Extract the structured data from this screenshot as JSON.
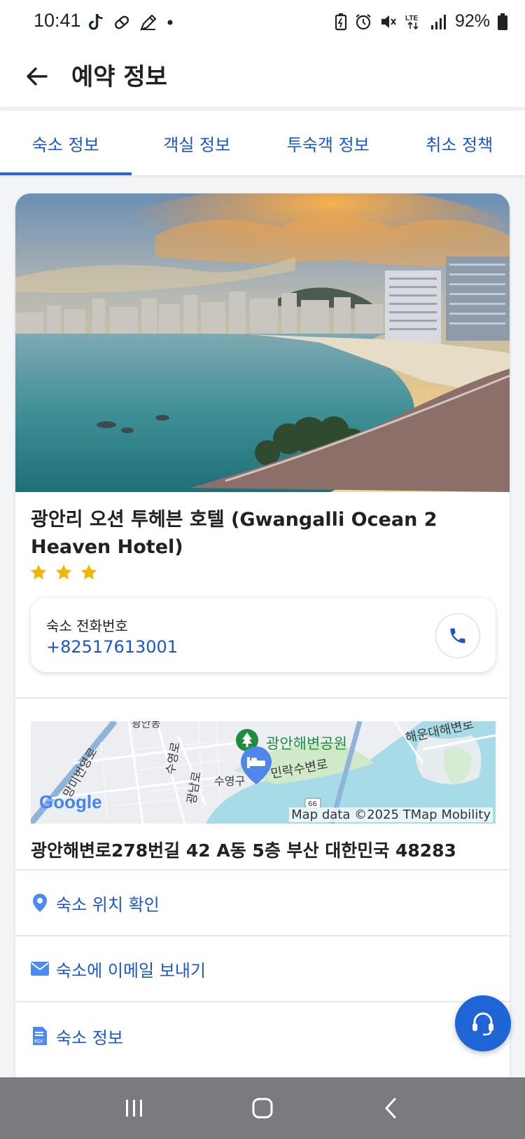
{
  "status_bar": {
    "time": "10:41",
    "battery_percent": "92%",
    "network": "LTE",
    "left_icons": [
      "tiktok-icon",
      "pill-icon",
      "pencil-icon",
      "dot-icon"
    ],
    "right_icons": [
      "battery-saver-icon",
      "alarm-icon",
      "mute-icon",
      "lte-icon",
      "signal-icon",
      "battery-icon"
    ]
  },
  "app_bar": {
    "title": "예약 정보",
    "back_icon": "arrow-left-icon"
  },
  "tabs": [
    {
      "label": "숙소 정보",
      "active": true
    },
    {
      "label": "객실 정보",
      "active": false
    },
    {
      "label": "투숙객 정보",
      "active": false
    },
    {
      "label": "취소 정책",
      "active": false
    }
  ],
  "hotel": {
    "name": "광안리 오션 투헤븐 호텔 (Gwangalli Ocean 2 Heaven Hotel)",
    "star_rating": 3,
    "star_color": "#f4b400",
    "phone_label": "숙소 전화번호",
    "phone_number": "+82517613001"
  },
  "map": {
    "labels": {
      "park": "광안해변공원",
      "road_top_right": "해운대해변로",
      "district": "수영구",
      "road_mid": "민락수변로",
      "road_left1": "수영로",
      "road_left2": "광남로",
      "road_left3": "망미번영로",
      "top_left": "광안동",
      "route_shield": "66"
    },
    "logo": "Google",
    "attribution": "Map data ©2025 TMap Mobility"
  },
  "address": "광안해변로278번길 42 A동 5층 부산 대한민국 48283",
  "actions": [
    {
      "label": "숙소 위치 확인",
      "icon": "location-pin-icon"
    },
    {
      "label": "숙소에 이메일 보내기",
      "icon": "mail-icon"
    },
    {
      "label": "숙소 정보",
      "icon": "pdf-icon"
    }
  ],
  "colors": {
    "link_blue": "#1a56c9",
    "accent_blue": "#2965d6",
    "fab_blue": "#1f65d6",
    "nav_gray": "#7a7b7e"
  }
}
